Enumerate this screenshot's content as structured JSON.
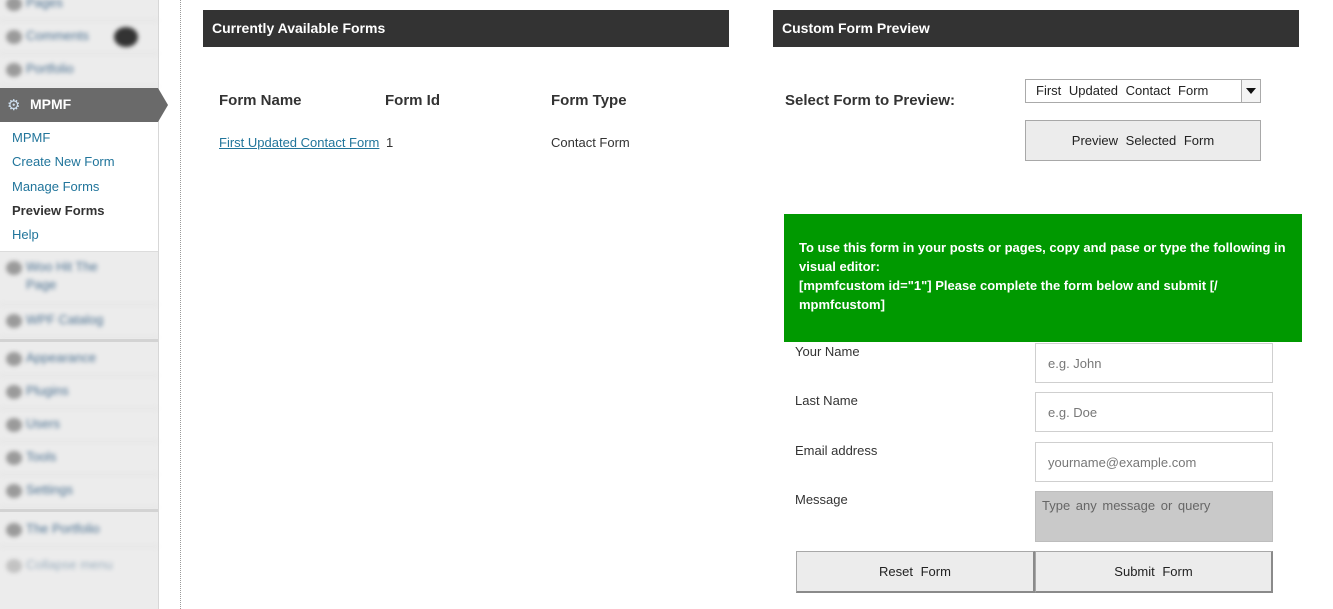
{
  "sidebar": {
    "blurred_top": [
      {
        "label": "Pages",
        "icon": "pages-icon"
      },
      {
        "label": "Comments",
        "icon": "comments-icon"
      },
      {
        "label": "Portfolio",
        "icon": "portfolio-icon"
      }
    ],
    "active_menu": {
      "label": "MPMF",
      "icon": "gear-icon"
    },
    "submenu": [
      {
        "label": "MPMF"
      },
      {
        "label": "Create New Form"
      },
      {
        "label": "Manage Forms"
      },
      {
        "label": "Preview Forms",
        "current": true
      },
      {
        "label": "Help"
      }
    ],
    "blurred_bottom": [
      {
        "label": "Woo Hit The",
        "label2": "Page",
        "icon": "plugin-icon"
      },
      {
        "label": "WPF Catalog",
        "icon": "catalog-icon"
      },
      {
        "label": "Appearance",
        "icon": "appearance-icon"
      },
      {
        "label": "Plugins",
        "icon": "plugins-icon"
      },
      {
        "label": "Users",
        "icon": "users-icon"
      },
      {
        "label": "Tools",
        "icon": "tools-icon"
      },
      {
        "label": "Settings",
        "icon": "settings-icon"
      },
      {
        "label": "The Portfolio",
        "icon": "portfolio-icon"
      },
      {
        "label": "Collapse menu",
        "icon": "collapse-icon"
      }
    ]
  },
  "left_panel": {
    "title": "Currently Available Forms",
    "columns": [
      "Form Name",
      "Form Id",
      "Form Type"
    ],
    "rows": [
      {
        "name": "First Updated Contact Form",
        "id": "1",
        "type": "Contact Form"
      }
    ]
  },
  "right_panel": {
    "title": "Custom Form Preview",
    "select_label": "Select Form to Preview:",
    "selected_form": "First Updated Contact Form",
    "preview_button": "Preview Selected Form",
    "notice_line1": "To use this form in your posts or pages, copy and pase or type the following in visual editor:",
    "notice_line2": "[mpmfcustom id=\"1\"] Please complete the form below and submit [/ mpmfcustom]",
    "fields": [
      {
        "label": "Your Name",
        "placeholder": "e.g. John"
      },
      {
        "label": "Last Name",
        "placeholder": "e.g. Doe"
      },
      {
        "label": "Email address",
        "placeholder": "yourname@example.com"
      },
      {
        "label": "Message",
        "placeholder": "Type any message or query"
      }
    ],
    "reset_button": "Reset Form",
    "submit_button": "Submit Form"
  },
  "colors": {
    "panel_header": "#333333",
    "notice_bg": "#009900",
    "link": "#21759b",
    "active_menu_bg": "#6a6a6a"
  }
}
